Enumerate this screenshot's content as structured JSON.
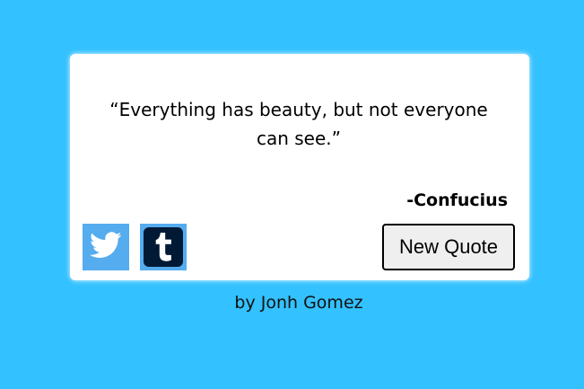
{
  "theme": {
    "background": "#33c1ff",
    "card_background": "#ffffff",
    "twitter_color": "#55acee",
    "tumblr_color": "#001935"
  },
  "quote": {
    "text": "“Everything has beauty, but not everyone can see.”",
    "author": "-Confucius"
  },
  "actions": {
    "twitter_icon": "twitter-icon",
    "tumblr_icon": "tumblr-icon",
    "new_quote_label": "New Quote"
  },
  "footer": {
    "byline": "by Jonh Gomez"
  }
}
